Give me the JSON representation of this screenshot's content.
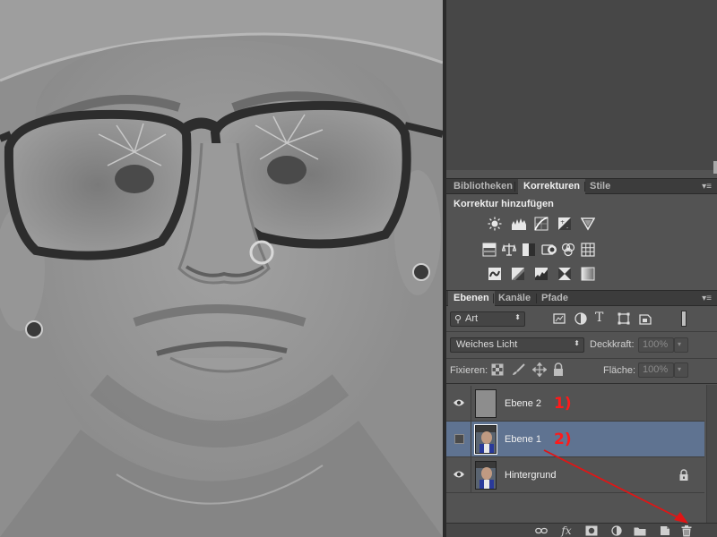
{
  "panels": {
    "adjust_tabs": [
      "Bibliotheken",
      "Korrekturen",
      "Stile"
    ],
    "adjust_active": "Korrekturen",
    "adjust_title": "Korrektur hinzufügen",
    "adjust_icons": {
      "row1": [
        "brightness-contrast-icon",
        "levels-icon",
        "curves-icon",
        "exposure-icon",
        "vibrance-icon"
      ],
      "row2": [
        "hue-saturation-icon",
        "color-balance-icon",
        "black-white-icon",
        "photo-filter-icon",
        "channel-mixer-icon",
        "color-lookup-icon"
      ],
      "row3": [
        "invert-icon",
        "posterize-icon",
        "threshold-icon",
        "selective-color-icon",
        "gradient-map-icon"
      ]
    },
    "layer_tabs": [
      "Ebenen",
      "Kanäle",
      "Pfade"
    ],
    "layer_active": "Ebenen",
    "panel_menu": "▾≡"
  },
  "layers_panel": {
    "filter_value": "Art",
    "blend_mode": "Weiches Licht",
    "opacity_label": "Deckkraft:",
    "opacity_value": "100%",
    "lock_label": "Fixieren:",
    "fill_label": "Fläche:",
    "fill_value": "100%",
    "layers": [
      {
        "name": "Ebene 2",
        "visible": true,
        "selected": false
      },
      {
        "name": "Ebene 1",
        "visible": false,
        "selected": true
      },
      {
        "name": "Hintergrund",
        "visible": true,
        "selected": false,
        "locked": true
      }
    ]
  },
  "annotations": {
    "one": "1)",
    "two": "2)"
  },
  "footer_icons": [
    "link-layers-icon",
    "fx-icon",
    "add-mask-icon",
    "new-adjustment-icon",
    "new-group-icon",
    "new-layer-icon",
    "delete-layer-icon"
  ],
  "footer_fx": "fx",
  "colors": {
    "accent_selected": "#5f7391",
    "annotation": "#ff1a1a",
    "panel_bg": "#535353"
  }
}
